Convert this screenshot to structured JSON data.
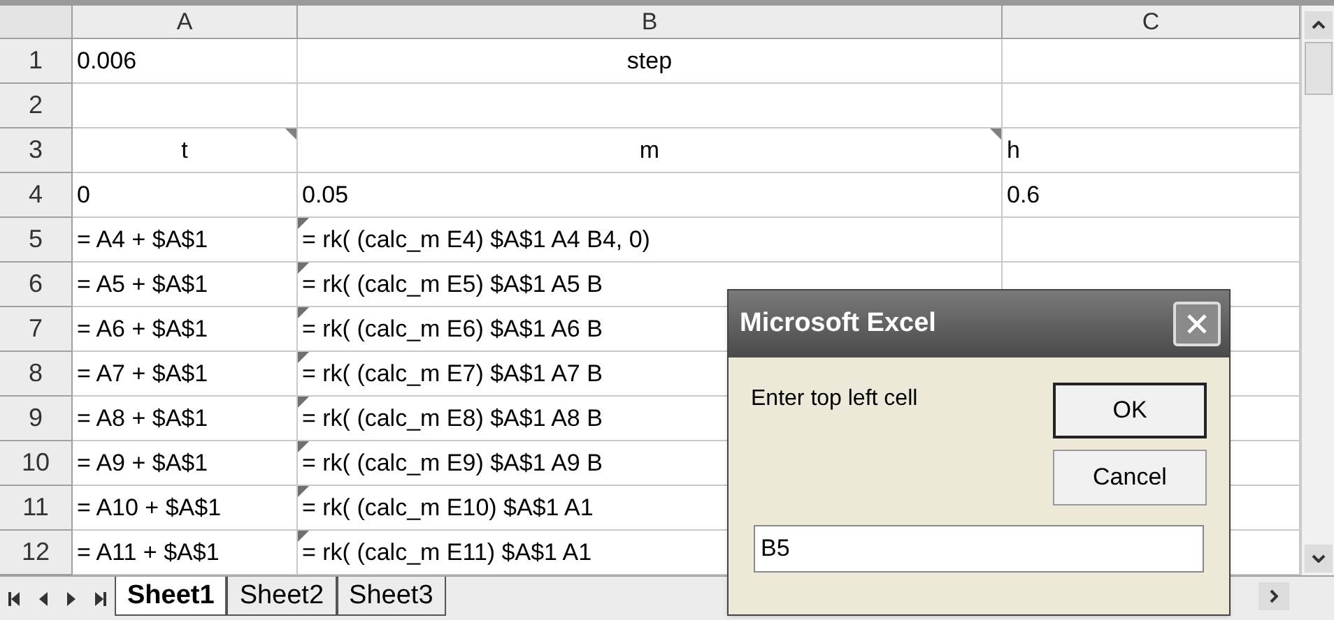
{
  "columns": [
    "A",
    "B",
    "C"
  ],
  "rows": [
    {
      "header": "1",
      "cells": [
        {
          "kind": "value",
          "text": "0.006"
        },
        {
          "kind": "heading",
          "text": "step"
        },
        {
          "kind": "value"
        }
      ]
    },
    {
      "header": "2",
      "cells": [
        {
          "kind": "value"
        },
        {
          "kind": "value"
        },
        {
          "kind": "value"
        }
      ]
    },
    {
      "header": "3",
      "cells": [
        {
          "kind": "heading",
          "text": "t",
          "note": true
        },
        {
          "kind": "heading",
          "text": "m",
          "note": true
        },
        {
          "kind": "value",
          "text": "h"
        }
      ]
    },
    {
      "header": "4",
      "cells": [
        {
          "kind": "value",
          "text": "0"
        },
        {
          "kind": "value",
          "text": "0.05"
        },
        {
          "kind": "value",
          "text": "0.6"
        }
      ]
    },
    {
      "header": "5",
      "cells": [
        {
          "kind": "value",
          "text": "= A4 + $A$1"
        },
        {
          "kind": "value",
          "text": "= rk( (calc_m E4) $A$1 A4 B4, 0)",
          "error": true
        },
        {
          "kind": "value"
        }
      ]
    },
    {
      "header": "6",
      "cells": [
        {
          "kind": "value",
          "text": "= A5 + $A$1"
        },
        {
          "kind": "value",
          "text": "= rk( (calc_m E5) $A$1 A5 B",
          "error": true
        },
        {
          "kind": "value"
        }
      ]
    },
    {
      "header": "7",
      "cells": [
        {
          "kind": "value",
          "text": "= A6 + $A$1"
        },
        {
          "kind": "value",
          "text": "= rk( (calc_m E6) $A$1 A6 B",
          "error": true
        },
        {
          "kind": "value"
        }
      ]
    },
    {
      "header": "8",
      "cells": [
        {
          "kind": "value",
          "text": "= A7 + $A$1"
        },
        {
          "kind": "value",
          "text": "= rk( (calc_m E7) $A$1 A7 B",
          "error": true
        },
        {
          "kind": "value"
        }
      ]
    },
    {
      "header": "9",
      "cells": [
        {
          "kind": "value",
          "text": "= A8 + $A$1"
        },
        {
          "kind": "value",
          "text": "= rk( (calc_m E8) $A$1 A8 B",
          "error": true
        },
        {
          "kind": "value"
        }
      ]
    },
    {
      "header": "10",
      "cells": [
        {
          "kind": "value",
          "text": "= A9 + $A$1"
        },
        {
          "kind": "value",
          "text": "= rk( (calc_m E9) $A$1 A9 B",
          "error": true
        },
        {
          "kind": "value"
        }
      ]
    },
    {
      "header": "11",
      "cells": [
        {
          "kind": "value",
          "text": "= A10 + $A$1"
        },
        {
          "kind": "value",
          "text": "= rk( (calc_m E10) $A$1 A1",
          "error": true
        },
        {
          "kind": "value"
        }
      ]
    },
    {
      "header": "12",
      "cells": [
        {
          "kind": "value",
          "text": "= A11 + $A$1"
        },
        {
          "kind": "value",
          "text": "= rk( (calc_m E11) $A$1 A1",
          "error": true
        },
        {
          "kind": "value"
        }
      ]
    }
  ],
  "sheet_tabs": [
    {
      "label": "Sheet1",
      "selected": true
    },
    {
      "label": "Sheet2",
      "selected": false
    },
    {
      "label": "Sheet3",
      "selected": false
    }
  ],
  "dialog": {
    "title": "Microsoft Excel",
    "prompt": "Enter top left cell",
    "buttons": [
      {
        "label": "OK",
        "default": true
      },
      {
        "label": "Cancel",
        "default": false
      }
    ],
    "input": "B5"
  }
}
